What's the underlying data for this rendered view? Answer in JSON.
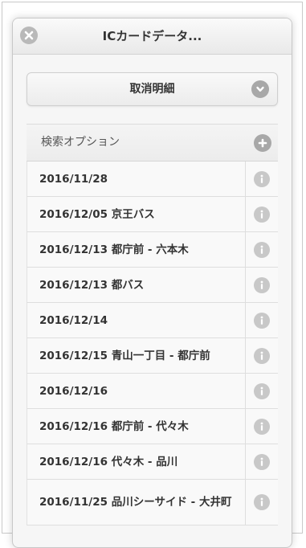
{
  "header": {
    "title": "ICカードデータ..."
  },
  "main": {
    "select_label": "取消明細",
    "collapsible_label": "検索オプション"
  },
  "list": [
    {
      "label": "2016/11/28"
    },
    {
      "label": "2016/12/05 京王バス"
    },
    {
      "label": "2016/12/13 都庁前 - 六本木"
    },
    {
      "label": "2016/12/13 都バス"
    },
    {
      "label": "2016/12/14"
    },
    {
      "label": "2016/12/15 青山一丁目 - 都庁前"
    },
    {
      "label": "2016/12/16"
    },
    {
      "label": "2016/12/16 都庁前 - 代々木"
    },
    {
      "label": "2016/12/16 代々木 - 品川"
    },
    {
      "label": "2016/11/25 品川シーサイド - 大井町"
    }
  ],
  "icons": {
    "close": "close-icon",
    "select": "chevron-down-icon",
    "expand": "plus-icon",
    "row": "info-icon"
  }
}
